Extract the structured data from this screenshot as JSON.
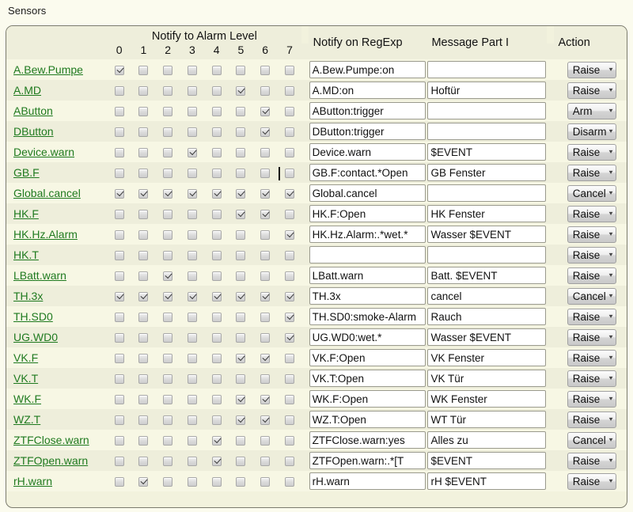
{
  "page": {
    "title": "Sensors",
    "link_color": "#1f7a1f",
    "frame_bg": "#f2f2dd",
    "row_alt_bg": "#eeeedb",
    "page_bg": "#fbfbee"
  },
  "header": {
    "group_label": "Notify to Alarm Level",
    "levels": [
      "0",
      "1",
      "2",
      "3",
      "4",
      "5",
      "6",
      "7"
    ],
    "regexp_label": "Notify on RegExp",
    "message_label": "Message Part I",
    "action_label": "Action"
  },
  "caret": {
    "visible": true,
    "row": "GB.F"
  },
  "rows": [
    {
      "name": "A.Bew.Pumpe",
      "checks": [
        true,
        false,
        false,
        false,
        false,
        false,
        false,
        false
      ],
      "regexp": "A.Bew.Pumpe:on",
      "message": "",
      "action": "Raise"
    },
    {
      "name": "A.MD",
      "checks": [
        false,
        false,
        false,
        false,
        false,
        true,
        false,
        false
      ],
      "regexp": "A.MD:on",
      "message": "Hoftür",
      "action": "Raise"
    },
    {
      "name": "AButton",
      "checks": [
        false,
        false,
        false,
        false,
        false,
        false,
        true,
        false
      ],
      "regexp": "AButton:trigger",
      "message": "",
      "action": "Arm"
    },
    {
      "name": "DButton",
      "checks": [
        false,
        false,
        false,
        false,
        false,
        false,
        true,
        false
      ],
      "regexp": "DButton:trigger",
      "message": "",
      "action": "Disarm"
    },
    {
      "name": "Device.warn",
      "checks": [
        false,
        false,
        false,
        true,
        false,
        false,
        false,
        false
      ],
      "regexp": "Device.warn",
      "message": "$EVENT",
      "action": "Raise"
    },
    {
      "name": "GB.F",
      "checks": [
        false,
        false,
        false,
        false,
        false,
        false,
        false,
        false
      ],
      "regexp": "GB.F:contact.*Open",
      "message": "GB Fenster",
      "action": "Raise"
    },
    {
      "name": "Global.cancel",
      "checks": [
        true,
        true,
        true,
        true,
        true,
        true,
        true,
        true
      ],
      "regexp": "Global.cancel",
      "message": "",
      "action": "Cancel"
    },
    {
      "name": "HK.F",
      "checks": [
        false,
        false,
        false,
        false,
        false,
        true,
        true,
        false
      ],
      "regexp": "HK.F:Open",
      "message": "HK Fenster",
      "action": "Raise"
    },
    {
      "name": "HK.Hz.Alarm",
      "checks": [
        false,
        false,
        false,
        false,
        false,
        false,
        false,
        true
      ],
      "regexp": "HK.Hz.Alarm:.*wet.*",
      "message": "Wasser $EVENT",
      "action": "Raise"
    },
    {
      "name": "HK.T",
      "checks": [
        false,
        false,
        false,
        false,
        false,
        false,
        false,
        false
      ],
      "regexp": "",
      "message": "",
      "action": "Raise"
    },
    {
      "name": "LBatt.warn",
      "checks": [
        false,
        false,
        true,
        false,
        false,
        false,
        false,
        false
      ],
      "regexp": "LBatt.warn",
      "message": "Batt. $EVENT",
      "action": "Raise"
    },
    {
      "name": "TH.3x",
      "checks": [
        true,
        true,
        true,
        true,
        true,
        true,
        true,
        true
      ],
      "regexp": "TH.3x",
      "message": "cancel",
      "action": "Cancel"
    },
    {
      "name": "TH.SD0",
      "checks": [
        false,
        false,
        false,
        false,
        false,
        false,
        false,
        true
      ],
      "regexp": "TH.SD0:smoke-Alarm",
      "message": "Rauch",
      "action": "Raise"
    },
    {
      "name": "UG.WD0",
      "checks": [
        false,
        false,
        false,
        false,
        false,
        false,
        false,
        true
      ],
      "regexp": "UG.WD0:wet.*",
      "message": "Wasser $EVENT",
      "action": "Raise"
    },
    {
      "name": "VK.F",
      "checks": [
        false,
        false,
        false,
        false,
        false,
        true,
        true,
        false
      ],
      "regexp": "VK.F:Open",
      "message": "VK Fenster",
      "action": "Raise"
    },
    {
      "name": "VK.T",
      "checks": [
        false,
        false,
        false,
        false,
        false,
        false,
        false,
        false
      ],
      "regexp": "VK.T:Open",
      "message": "VK Tür",
      "action": "Raise"
    },
    {
      "name": "WK.F",
      "checks": [
        false,
        false,
        false,
        false,
        false,
        true,
        true,
        false
      ],
      "regexp": "WK.F:Open",
      "message": "WK Fenster",
      "action": "Raise"
    },
    {
      "name": "WZ.T",
      "checks": [
        false,
        false,
        false,
        false,
        false,
        true,
        true,
        false
      ],
      "regexp": "WZ.T:Open",
      "message": "WT Tür",
      "action": "Raise"
    },
    {
      "name": "ZTFClose.warn",
      "checks": [
        false,
        false,
        false,
        false,
        true,
        false,
        false,
        false
      ],
      "regexp": "ZTFClose.warn:yes",
      "message": "Alles zu",
      "action": "Cancel"
    },
    {
      "name": "ZTFOpen.warn",
      "checks": [
        false,
        false,
        false,
        false,
        true,
        false,
        false,
        false
      ],
      "regexp": "ZTFOpen.warn:.*[T",
      "message": "$EVENT",
      "action": "Raise"
    },
    {
      "name": "rH.warn",
      "checks": [
        false,
        true,
        false,
        false,
        false,
        false,
        false,
        false
      ],
      "regexp": "rH.warn",
      "message": "rH $EVENT",
      "action": "Raise"
    }
  ]
}
